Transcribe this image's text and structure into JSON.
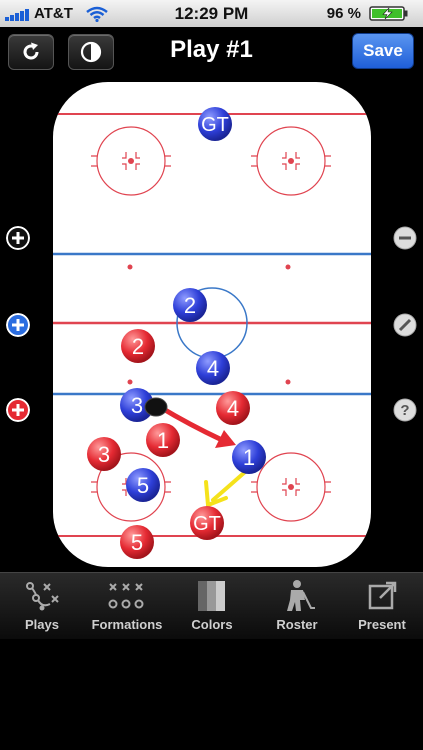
{
  "status": {
    "carrier": "AT&T",
    "time": "12:29 PM",
    "battery": "96 %"
  },
  "header": {
    "title": "Play #1",
    "save_label": "Save"
  },
  "tabs": [
    {
      "label": "Plays",
      "icon": "plays-icon"
    },
    {
      "label": "Formations",
      "icon": "formations-icon"
    },
    {
      "label": "Colors",
      "icon": "colors-icon"
    },
    {
      "label": "Roster",
      "icon": "roster-icon"
    },
    {
      "label": "Present",
      "icon": "present-icon"
    }
  ],
  "players": {
    "blue": [
      "GT",
      "2",
      "4",
      "3",
      "1",
      "5"
    ],
    "red": [
      "2",
      "4",
      "1",
      "3",
      "GT",
      "5"
    ]
  },
  "colors": {
    "blue": "#2e3fd8",
    "red": "#e52a33",
    "rink_red": "#e04450",
    "rink_blue": "#3a78c8",
    "accent": "#2b6de0"
  }
}
